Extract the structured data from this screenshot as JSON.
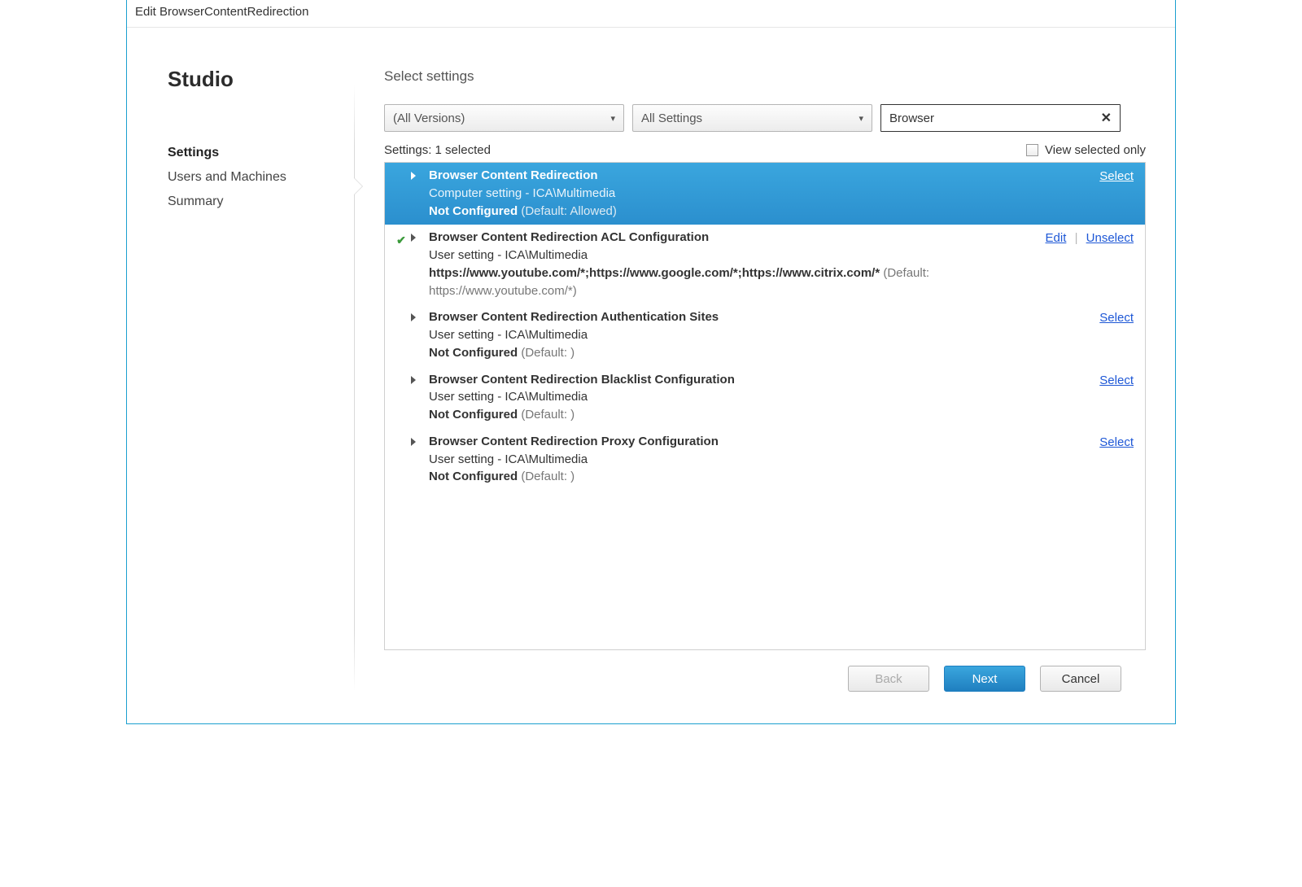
{
  "window": {
    "title": "Edit BrowserContentRedirection"
  },
  "sidebar": {
    "brand": "Studio",
    "items": [
      {
        "label": "Settings",
        "active": true
      },
      {
        "label": "Users and Machines",
        "active": false
      },
      {
        "label": "Summary",
        "active": false
      }
    ]
  },
  "main": {
    "heading": "Select settings",
    "version_dropdown": "(All Versions)",
    "scope_dropdown": "All Settings",
    "search_value": "Browser",
    "count_label": "Settings:",
    "count_value": "1 selected",
    "view_selected_only_label": "View selected only"
  },
  "settings": [
    {
      "selected_row": true,
      "checked": false,
      "title": "Browser Content Redirection",
      "sub": "Computer setting - ICA\\Multimedia",
      "state_bold": "Not Configured",
      "state_def": "(Default: Allowed)",
      "actions": [
        {
          "label": "Select"
        }
      ]
    },
    {
      "selected_row": false,
      "checked": true,
      "title": "Browser Content Redirection ACL Configuration",
      "sub": "User setting - ICA\\Multimedia",
      "state_bold": "https://www.youtube.com/*;https://www.google.com/*;https://www.citrix.com/*",
      "state_def": "(Default: https://www.youtube.com/*)",
      "actions": [
        {
          "label": "Edit"
        },
        {
          "label": "Unselect"
        }
      ]
    },
    {
      "selected_row": false,
      "checked": false,
      "title": "Browser Content Redirection Authentication Sites",
      "sub": "User setting - ICA\\Multimedia",
      "state_bold": "Not Configured",
      "state_def": "(Default: )",
      "actions": [
        {
          "label": "Select"
        }
      ]
    },
    {
      "selected_row": false,
      "checked": false,
      "title": "Browser Content Redirection Blacklist Configuration",
      "sub": "User setting - ICA\\Multimedia",
      "state_bold": "Not Configured",
      "state_def": "(Default: )",
      "actions": [
        {
          "label": "Select"
        }
      ]
    },
    {
      "selected_row": false,
      "checked": false,
      "title": "Browser Content Redirection Proxy Configuration",
      "sub": "User setting - ICA\\Multimedia",
      "state_bold": "Not Configured",
      "state_def": "(Default: )",
      "actions": [
        {
          "label": "Select"
        }
      ]
    }
  ],
  "footer": {
    "back": "Back",
    "next": "Next",
    "cancel": "Cancel"
  }
}
